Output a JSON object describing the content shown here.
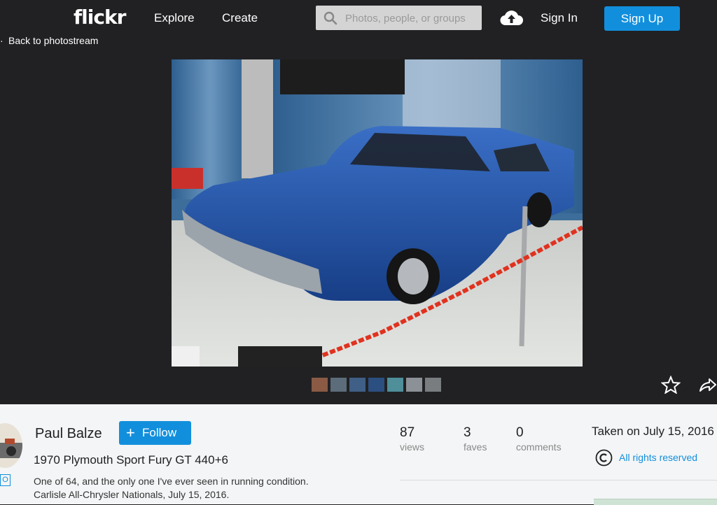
{
  "header": {
    "logo": "flickr",
    "nav": [
      "Explore",
      "Create"
    ],
    "search_placeholder": "Photos, people, or groups",
    "sign_in": "Sign In",
    "sign_up": "Sign Up",
    "colors": {
      "bar": "#212124",
      "accent": "#128fdc"
    }
  },
  "viewer": {
    "back_label": "Back to photostream",
    "photo_subject": "blue car",
    "filmstrip_count": 7,
    "icons": [
      "star-icon",
      "share-arrow-icon"
    ]
  },
  "info": {
    "user_name": "Paul Balze",
    "follow_label": "Follow",
    "pro_badge": "O",
    "title": "1970 Plymouth Sport Fury GT 440+6",
    "description_line1": "One of 64, and the only one I've ever seen in running condition.",
    "description_line2": "Carlisle All-Chrysler Nationals, July 15, 2016.",
    "stats": [
      {
        "value": "87",
        "label": "views"
      },
      {
        "value": "3",
        "label": "faves"
      },
      {
        "value": "0",
        "label": "comments"
      }
    ],
    "taken": "Taken on July 15, 2016",
    "license": "All rights reserved"
  }
}
